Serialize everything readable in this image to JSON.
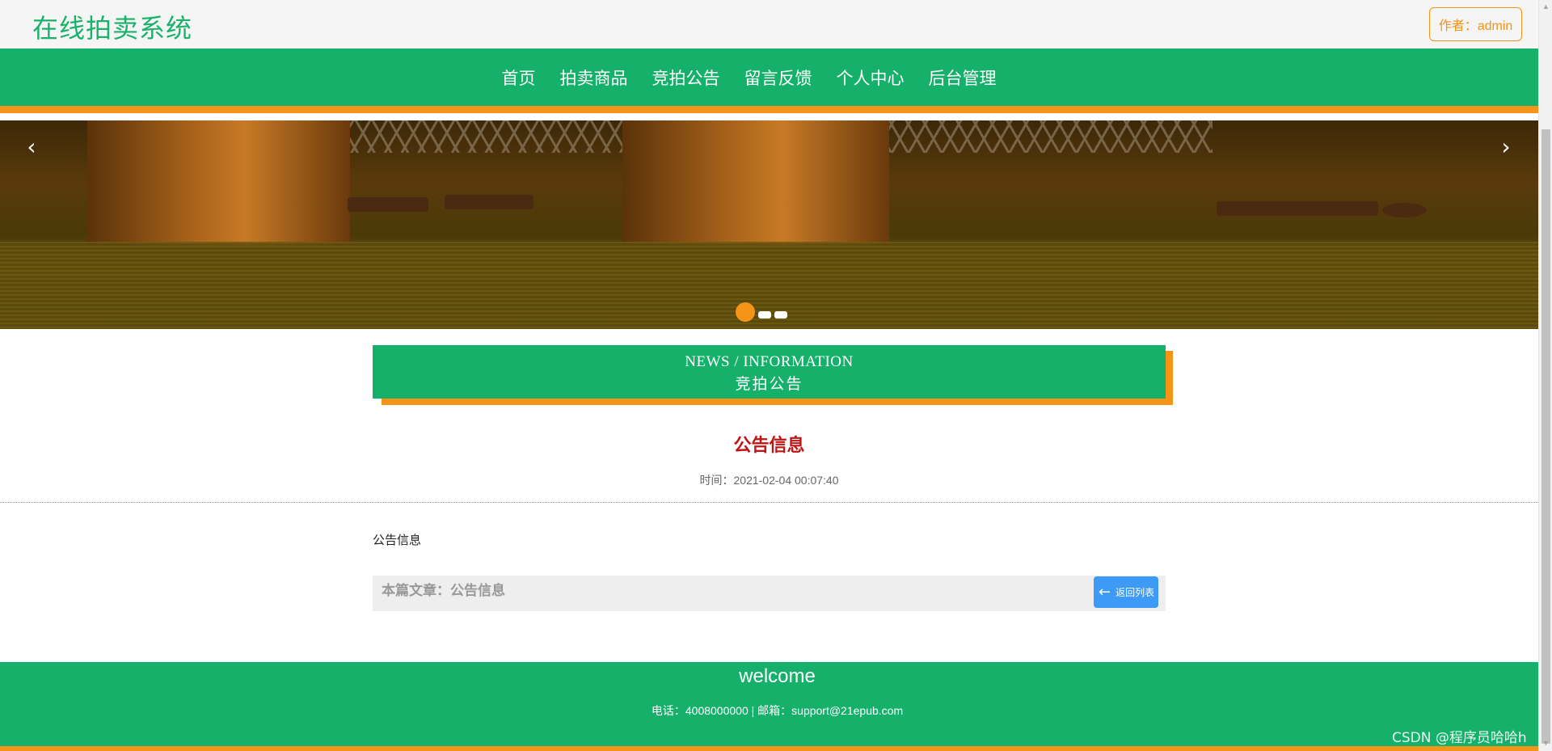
{
  "header": {
    "site_title": "在线拍卖系统",
    "author_label": "作者：admin"
  },
  "nav": {
    "items": [
      "首页",
      "拍卖商品",
      "竞拍公告",
      "留言反馈",
      "个人中心",
      "后台管理"
    ]
  },
  "banner": {
    "prev_icon": "chevron-left-icon",
    "next_icon": "chevron-right-icon",
    "prev_glyph": "‹",
    "next_glyph": "›",
    "slide_count": 3,
    "active_slide": 1
  },
  "section": {
    "title_en": "NEWS / INFORMATION",
    "title_cn": "竞拍公告"
  },
  "article": {
    "title": "公告信息",
    "time": "时间：2021-02-04 00:07:40",
    "body": "公告信息",
    "current_label": "本篇文章：公告信息",
    "back_label": "返回列表",
    "back_icon": "arrow-left-icon",
    "back_glyph": "←"
  },
  "footer": {
    "title": "welcome",
    "contact": "电话：4008000000 | 邮箱：support@21epub.com"
  },
  "watermark": "CSDN @程序员哈哈h",
  "colors": {
    "brand_green": "#15b06a",
    "accent_orange": "#f59518",
    "title_red": "#c11515",
    "button_blue": "#3d9bf6"
  }
}
